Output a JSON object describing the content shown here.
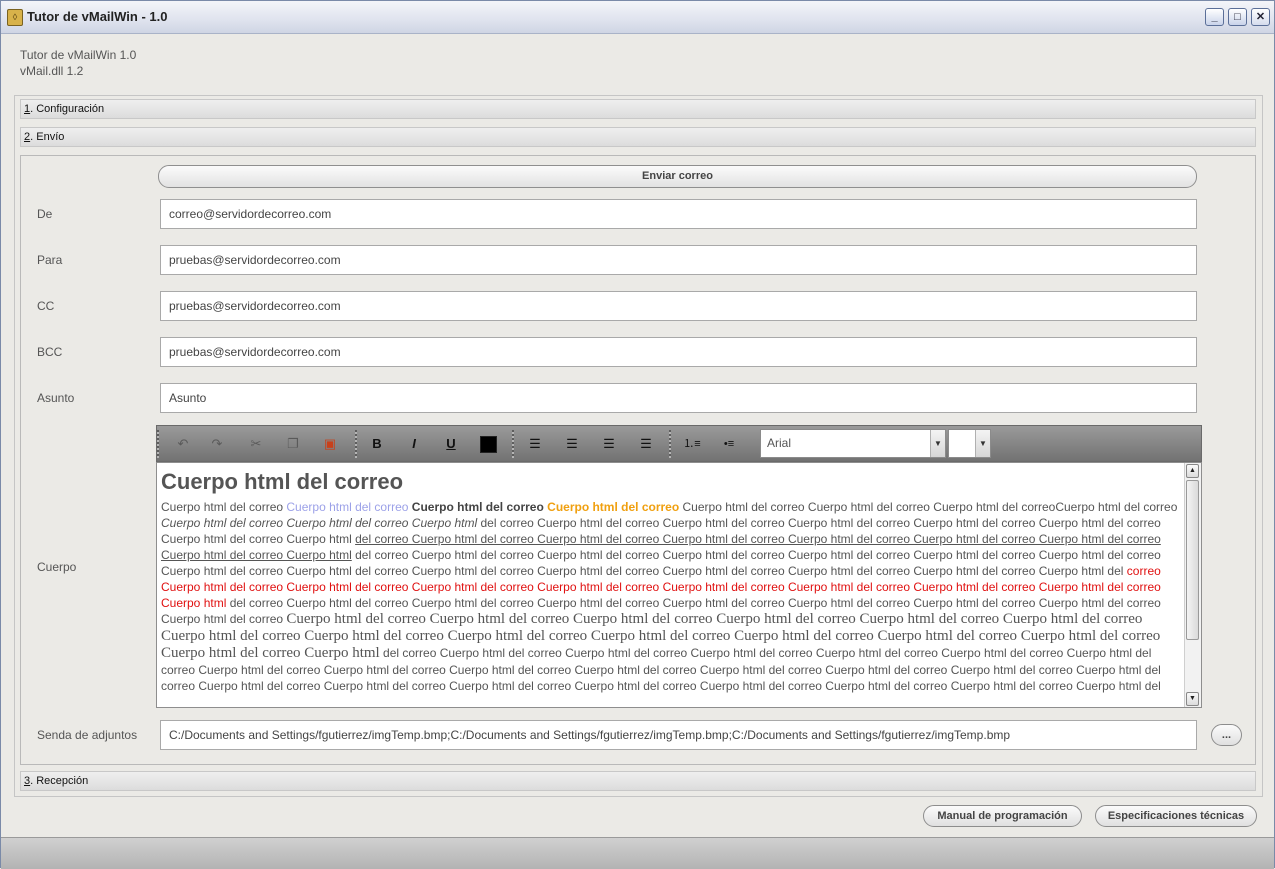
{
  "window": {
    "title": "Tutor de vMailWin - 1.0",
    "icon": "shield-icon"
  },
  "info": {
    "line1": "Tutor de vMailWin 1.0",
    "line2": "vMail.dll 1.2"
  },
  "sections": {
    "config": {
      "key": "1",
      "label": ". Configuración"
    },
    "envio": {
      "key": "2",
      "label": ". Envío"
    },
    "recepcion": {
      "key": "3",
      "label": ". Recepción"
    }
  },
  "send_button": "Enviar correo",
  "fields": {
    "de": {
      "label": "De",
      "value": "correo@servidordecorreo.com"
    },
    "para": {
      "label": "Para",
      "value": "pruebas@servidordecorreo.com"
    },
    "cc": {
      "label": "CC",
      "value": "pruebas@servidordecorreo.com"
    },
    "bcc": {
      "label": "BCC",
      "value": "pruebas@servidordecorreo.com"
    },
    "asunto": {
      "label": "Asunto",
      "value": "Asunto"
    },
    "cuerpo": {
      "label": "Cuerpo"
    },
    "adjuntos": {
      "label": "Senda de adjuntos",
      "value": "C:/Documents and Settings/fgutierrez/imgTemp.bmp;C:/Documents and Settings/fgutierrez/imgTemp.bmp;C:/Documents and Settings/fgutierrez/imgTemp.bmp"
    }
  },
  "browse_button": "...",
  "toolbar": {
    "bold": "B",
    "italic": "I",
    "underline": "U",
    "font": "Arial",
    "size": ""
  },
  "editor": {
    "heading": "Cuerpo html del correo",
    "runs": {
      "r1": "Cuerpo html del correo ",
      "r2": "Cuerpo html del correo",
      "r3": " Cuerpo html del correo",
      "r4": " Cuerpo html del correo",
      "r5": " Cuerpo html del correo Cuerpo html del correo Cuerpo html del correoCuerpo html del correo ",
      "r6": "Cuerpo html del correo Cuerpo html del correo Cuerpo html",
      "r7": " del correo Cuerpo html del correo Cuerpo html del correo Cuerpo html del correo Cuerpo html del correo Cuerpo html del correo Cuerpo html del correo Cuerpo html ",
      "r8": "del correo Cuerpo html del correo Cuerpo html del correo Cuerpo html del correo Cuerpo html del correo Cuerpo html del correo Cuerpo html del correo Cuerpo html del correo Cuerpo html",
      "r9": " del correo Cuerpo html del correo Cuerpo html del correo Cuerpo html del correo Cuerpo html del correo Cuerpo html del correo Cuerpo html del correo Cuerpo html del correo Cuerpo html del correo Cuerpo html del correo Cuerpo html del correo Cuerpo html del correo Cuerpo html del correo Cuerpo html del correo Cuerpo html del ",
      "r10": "correo Cuerpo html del correo Cuerpo html del correo Cuerpo html del correo Cuerpo html del correo Cuerpo html del correo Cuerpo html del correo Cuerpo html del correo Cuerpo html del correo Cuerpo html",
      "r11": " del correo Cuerpo html del correo Cuerpo html del correo Cuerpo html del correo Cuerpo html del correo Cuerpo html del correo Cuerpo html del correo Cuerpo html del correo Cuerpo html del correo ",
      "r12": "Cuerpo html del correo Cuerpo html del correo Cuerpo html del correo Cuerpo html del correo Cuerpo html del correo Cuerpo html del correo Cuerpo html del correo Cuerpo html del correo Cuerpo html del correo Cuerpo html del correo Cuerpo html del correo Cuerpo html del correo Cuerpo html del correo Cuerpo html del correo Cuerpo html",
      "r13": " del correo Cuerpo html del correo Cuerpo html del correo Cuerpo html del correo Cuerpo html del correo Cuerpo html del correo Cuerpo html del correo Cuerpo html del correo Cuerpo html del correo Cuerpo html del correo Cuerpo html del correo Cuerpo html del correo Cuerpo html del correo Cuerpo html del correo Cuerpo html del correo Cuerpo html del correo Cuerpo html del correo Cuerpo html del correo Cuerpo html del correo Cuerpo html del correo Cuerpo html del correo Cuerpo html del correo Cuerpo html del"
    }
  },
  "footer": {
    "manual": "Manual de programación",
    "specs": "Especificaciones técnicas"
  }
}
